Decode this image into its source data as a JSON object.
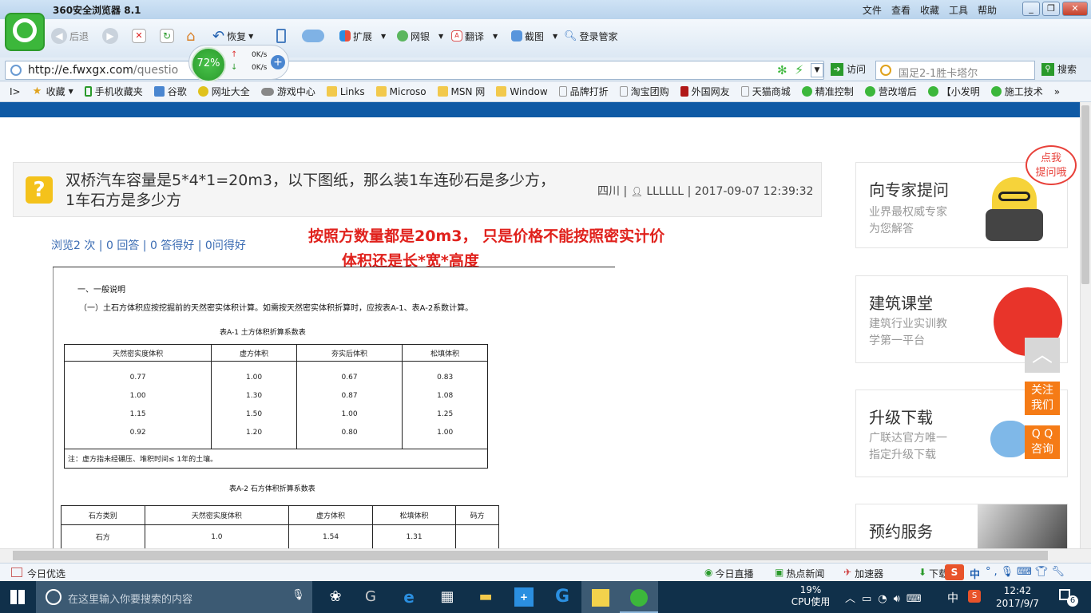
{
  "browser": {
    "title": "360安全浏览器 8.1",
    "menus": [
      "文件",
      "查看",
      "收藏",
      "工具",
      "帮助"
    ],
    "toolbar": {
      "back": "后退",
      "restore": "恢复",
      "extend": "扩展",
      "bank": "网银",
      "translate": "翻译",
      "screenshot": "截图",
      "login": "登录管家"
    },
    "speed": {
      "cpu": "72%",
      "up": "0K/s",
      "down": "0K/s"
    },
    "address": {
      "domain": "http://e.fwxgx.com",
      "path": "/questio"
    },
    "visit": "访问",
    "search_placeholder": "国足2-1胜卡塔尔",
    "search_button": "搜索",
    "favorites": [
      "收藏",
      "手机收藏夹",
      "谷歌",
      "网址大全",
      "游戏中心",
      "Links",
      "Microso",
      "MSN 网",
      "Window",
      "品牌打折",
      "淘宝团购",
      "外国网友",
      "天猫商城",
      "精准控制",
      "营改增后",
      "【小发明",
      "施工技术"
    ]
  },
  "question": {
    "title": "双桥汽车容量是5*4*1=20m3，以下图纸，那么装1车连砂石是多少方，1车石方是多少方",
    "region": "四川",
    "user": "LLLLLL",
    "datetime": "2017-09-07 12:39:32",
    "stats": "浏览2 次 | 0 回答 | 0 答得好 | 0问得好",
    "annotation_line1": "按照方数量都是20m3， 只是价格不能按照密实计价",
    "annotation_line2": "体积还是长*宽*高度"
  },
  "document": {
    "heading": "一、一般说明",
    "para": "（一）土石方体积应按挖掘前的天然密实体积计算。如需按天然密实体积折算时，应按表A-1、表A-2系数计算。",
    "table1_title": "表A-1   土方体积折算系数表",
    "table1_headers": [
      "天然密实度体积",
      "虚方体积",
      "夯实后体积",
      "松填体积"
    ],
    "table1_rows": [
      [
        "0.77",
        "1.00",
        "0.67",
        "0.83"
      ],
      [
        "1.00",
        "1.30",
        "0.87",
        "1.08"
      ],
      [
        "1.15",
        "1.50",
        "1.00",
        "1.25"
      ],
      [
        "0.92",
        "1.20",
        "0.80",
        "1.00"
      ]
    ],
    "table1_note": "注：虚方指未经碾压、堆积时间≤ 1年的土壤。",
    "table2_title": "表A-2   石方体积折算系数表",
    "table2_headers": [
      "石方类别",
      "天然密实度体积",
      "虚方体积",
      "松填体积",
      "码方"
    ],
    "table2_rows": [
      [
        "石方",
        "1.0",
        "1.54",
        "1.31",
        ""
      ]
    ]
  },
  "sidebar": {
    "bubble": "点我\n提问哦",
    "cards": [
      {
        "title": "向专家提问",
        "sub1": "业界最权威专家",
        "sub2": "为您解答"
      },
      {
        "title": "建筑课堂",
        "sub1": "建筑行业实训教",
        "sub2": "学第一平台"
      },
      {
        "title": "升级下载",
        "sub1": "广联达官方唯一",
        "sub2": "指定升级下载"
      },
      {
        "title": "预约服务",
        "sub1": "",
        "sub2": ""
      }
    ],
    "follow": "关注\n我们",
    "qq": "Q Q\n咨询"
  },
  "statusbar": {
    "left": "今日优选",
    "live": "今日直播",
    "news": "热点新闻",
    "accel": "加速器",
    "download": "下载",
    "ime": "中"
  },
  "taskbar": {
    "search_placeholder": "在这里输入你要搜索的内容",
    "cpu_pct": "19%",
    "cpu_label": "CPU使用",
    "ime": "中",
    "time": "12:42",
    "date": "2017/9/7",
    "notif": "6"
  },
  "colors": {
    "accent_blue": "#0f5aa5",
    "red_annotation": "#e0211c",
    "orange_float": "#f57b16",
    "question_yellow": "#f4c21b"
  }
}
